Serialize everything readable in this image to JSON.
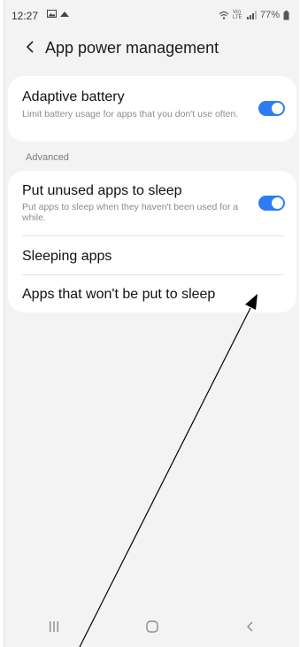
{
  "status_bar": {
    "time": "12:27",
    "left_icons": [
      "image-icon",
      "cloud-icon"
    ],
    "signal_label": "Vo) LTE",
    "battery_percent": "77%"
  },
  "header": {
    "title": "App power management",
    "back_icon": "chevron-left-icon"
  },
  "adaptive_battery": {
    "title": "Adaptive battery",
    "subtitle": "Limit battery usage for apps that you don't use often.",
    "enabled": true
  },
  "advanced": {
    "section_label": "Advanced",
    "items": [
      {
        "title": "Put unused apps to sleep",
        "subtitle": "Put apps to sleep when they haven't been used for a while.",
        "enabled": true
      },
      {
        "title": "Sleeping apps"
      },
      {
        "title": "Apps that won't be put to sleep"
      }
    ]
  },
  "nav_bar": {
    "items": [
      "recents-icon",
      "home-icon",
      "back-icon"
    ]
  },
  "colors": {
    "accent": "#2e7cf2",
    "background": "#f3f3f3",
    "card": "#ffffff"
  }
}
